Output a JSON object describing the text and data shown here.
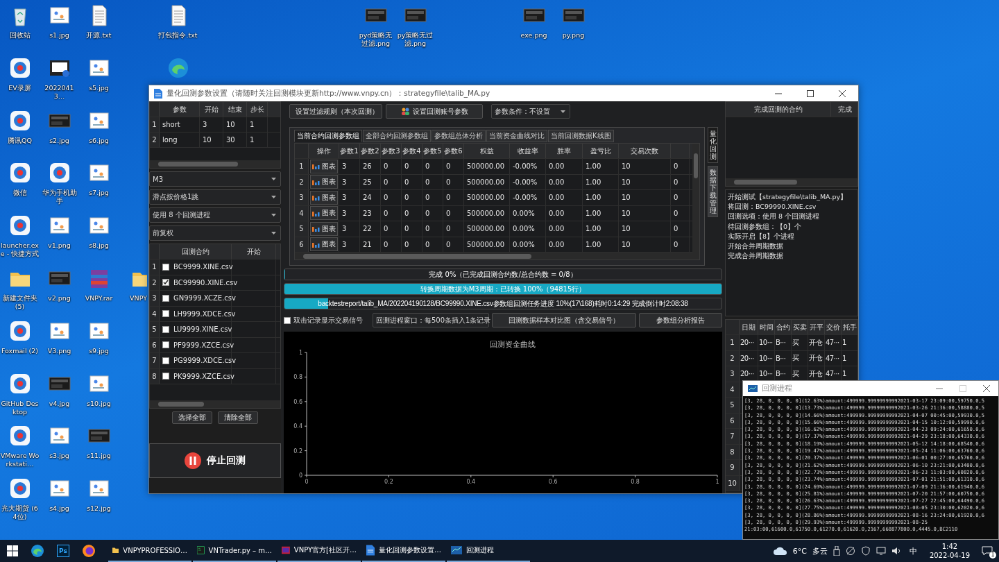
{
  "desktop": {
    "icons": [
      {
        "label": "回收站",
        "kind": "recycle"
      },
      {
        "label": "EV录屏",
        "kind": "app"
      },
      {
        "label": "腾讯QQ",
        "kind": "app"
      },
      {
        "label": "微信",
        "kind": "app"
      },
      {
        "label": "launcher.exe - 快捷方式",
        "kind": "app"
      },
      {
        "label": "新建文件夹 (5)",
        "kind": "folder"
      },
      {
        "label": "Foxmail (2)",
        "kind": "app"
      },
      {
        "label": "GitHub Desktop",
        "kind": "app"
      },
      {
        "label": "VMware Workstati…",
        "kind": "app"
      },
      {
        "label": "光大期货 (64位)",
        "kind": "app"
      },
      {
        "label": "s1.jpg",
        "kind": "image"
      },
      {
        "label": "20220413…",
        "kind": "video"
      },
      {
        "label": "s2.jpg",
        "kind": "dark"
      },
      {
        "label": "华为手机助手",
        "kind": "app"
      },
      {
        "label": "v1.png",
        "kind": "image"
      },
      {
        "label": "v2.png",
        "kind": "dark"
      },
      {
        "label": "V3.png",
        "kind": "image"
      },
      {
        "label": "v4.jpg",
        "kind": "dark"
      },
      {
        "label": "s3.jpg",
        "kind": "image"
      },
      {
        "label": "s4.jpg",
        "kind": "image"
      },
      {
        "label": "开源.txt",
        "kind": "text"
      },
      {
        "label": "s5.jpg",
        "kind": "image"
      },
      {
        "label": "s6.jpg",
        "kind": "image"
      },
      {
        "label": "s7.jpg",
        "kind": "image"
      },
      {
        "label": "s8.jpg",
        "kind": "image"
      },
      {
        "label": "VNPY.rar",
        "kind": "archive"
      },
      {
        "label": "s9.jpg",
        "kind": "image"
      },
      {
        "label": "s10.jpg",
        "kind": "image"
      },
      {
        "label": "s11.jpg",
        "kind": "dark"
      },
      {
        "label": "s12.jpg",
        "kind": "image"
      },
      {
        "label": "VNPY",
        "kind": "folder"
      },
      {
        "label": "打包指令.txt",
        "kind": "text"
      },
      {
        "kind": "edge"
      },
      {
        "label": "pyd策略无过滤.png",
        "kind": "dark"
      },
      {
        "label": "py策略无过滤.png",
        "kind": "dark"
      },
      {
        "label": "exe.png",
        "kind": "dark"
      },
      {
        "label": "py.png",
        "kind": "dark"
      }
    ]
  },
  "main_window": {
    "title": "量化回测参数设置（请随时关注回测模块更新http://www.vnpy.cn）：strategyfile\\talib_MA.py",
    "param_table": {
      "columns": [
        "参数",
        "开始",
        "结束",
        "步长"
      ],
      "rows": [
        {
          "no": "1",
          "cells": [
            "short",
            "3",
            "10",
            "1"
          ]
        },
        {
          "no": "2",
          "cells": [
            "long",
            "10",
            "30",
            "1"
          ]
        }
      ]
    },
    "dropdowns": [
      "M3",
      "滑点按价格1跳",
      "使用 8 个回测进程",
      "前复权"
    ],
    "contract_table": {
      "columns": [
        "回测合约",
        "开始"
      ],
      "rows": [
        {
          "no": "1",
          "name": "BC9999.XINE.csv",
          "checked": false
        },
        {
          "no": "2",
          "name": "BC99990.XINE.csv",
          "checked": true
        },
        {
          "no": "3",
          "name": "GN9999.XCZE.csv",
          "checked": false
        },
        {
          "no": "4",
          "name": "LH9999.XDCE.csv",
          "checked": false
        },
        {
          "no": "5",
          "name": "LU9999.XINE.csv",
          "checked": false
        },
        {
          "no": "6",
          "name": "PF9999.XZCE.csv",
          "checked": false
        },
        {
          "no": "7",
          "name": "PG9999.XDCE.csv",
          "checked": false
        },
        {
          "no": "8",
          "name": "PK9999.XZCE.csv",
          "checked": false
        }
      ]
    },
    "select_all_button": "选择全部",
    "clear_all_button": "清除全部",
    "stop_button": "停止回测",
    "filter_button": "设置过滤规则（本次回测）",
    "account_button": "设置回测账号参数",
    "condition_dropdown": "参数条件：不设置",
    "tabs": [
      {
        "label": "当前合约回测参数组",
        "selected": true
      },
      {
        "label": "全部合约回测参数组",
        "selected": false
      },
      {
        "label": "参数组总体分析",
        "selected": false
      },
      {
        "label": "当前资金曲线对比",
        "selected": false
      },
      {
        "label": "当前回测数据K线图",
        "selected": false
      }
    ],
    "result_table": {
      "columns": [
        "操作",
        "参数1",
        "参数2",
        "参数3",
        "参数4",
        "参数5",
        "参数6",
        "权益",
        "收益率",
        "胜率",
        "盈亏比",
        "交易次数"
      ],
      "rows": [
        {
          "no": "1",
          "cells": [
            "图表",
            "3",
            "26",
            "0",
            "0",
            "0",
            "0",
            "500000.00",
            "-0.00%",
            "0.00",
            "1.00",
            "10",
            "0"
          ]
        },
        {
          "no": "2",
          "cells": [
            "图表",
            "3",
            "25",
            "0",
            "0",
            "0",
            "0",
            "500000.00",
            "-0.00%",
            "0.00",
            "1.00",
            "10",
            "0"
          ]
        },
        {
          "no": "3",
          "cells": [
            "图表",
            "3",
            "24",
            "0",
            "0",
            "0",
            "0",
            "500000.00",
            "-0.00%",
            "0.00",
            "1.00",
            "10",
            "0"
          ]
        },
        {
          "no": "4",
          "cells": [
            "图表",
            "3",
            "23",
            "0",
            "0",
            "0",
            "0",
            "500000.00",
            "0.00%",
            "0.00",
            "1.00",
            "10",
            "0"
          ]
        },
        {
          "no": "5",
          "cells": [
            "图表",
            "3",
            "22",
            "0",
            "0",
            "0",
            "0",
            "500000.00",
            "0.00%",
            "0.00",
            "1.00",
            "10",
            "0"
          ]
        },
        {
          "no": "6",
          "cells": [
            "图表",
            "3",
            "21",
            "0",
            "0",
            "0",
            "0",
            "500000.00",
            "0.00%",
            "0.00",
            "1.00",
            "10",
            "0"
          ]
        }
      ]
    },
    "side_tabs": [
      {
        "label": "量化回测",
        "selected": true
      },
      {
        "label": "数据下载管理",
        "selected": false
      }
    ],
    "progress": [
      {
        "text": "完成 0%（已完成回测合约数/总合约数 = 0/8）",
        "level": 0
      },
      {
        "text": "转换周期数据为M3周期：已转换 100%（94815行）",
        "level": 1
      },
      {
        "text": "backtestreport/talib_MA/202204190128/BC99990.XINE.csv参数组回测任务进度 10%(17\\168)耗时0:14:29 完成倒计时2:08:38",
        "level": 0.1
      }
    ],
    "signal_checkbox": {
      "label": "双击记录显示交易信号",
      "checked": false
    },
    "log_dropdown": "回测进程窗口：每500条插入1条记录",
    "compare_button": "回测数据样本对比图（含交易信号）",
    "report_button": "参数组分析报告",
    "chart_data": {
      "type": "line",
      "title": "回测资金曲线",
      "xlim": [
        0,
        1
      ],
      "ylim": [
        0,
        1
      ],
      "xticks": [
        0,
        0.2,
        0.4,
        0.6,
        0.8,
        1
      ],
      "yticks": [
        0,
        0.2,
        0.4,
        0.6,
        0.8,
        1
      ]
    },
    "done_table": {
      "columns": [
        "完成回测的合约",
        "完成"
      ]
    },
    "log": [
      "开始测试【strategyfile\\talib_MA.py】",
      "将回测：BC99990.XINE.csv",
      "回测选项：使用 8 个回测进程",
      "待回测参数组：【0】个",
      "实际开启【8】个进程",
      "开始合并周期数据",
      "完成合并周期数据"
    ],
    "trade_table": {
      "columns": [
        "日期",
        "时间",
        "合约",
        "买卖",
        "开平",
        "交价",
        "托手"
      ],
      "rows": [
        {
          "no": "1",
          "cells": [
            "20···",
            "10···",
            "B···",
            "买",
            "开仓",
            "47···",
            "1"
          ]
        },
        {
          "no": "2",
          "cells": [
            "20···",
            "10···",
            "B···",
            "买",
            "开仓",
            "47···",
            "1"
          ]
        },
        {
          "no": "3",
          "cells": [
            "20···",
            "10···",
            "B···",
            "买",
            "开仓",
            "47···",
            "1"
          ]
        },
        {
          "no": "4"
        },
        {
          "no": "5"
        },
        {
          "no": "6"
        },
        {
          "no": "7"
        },
        {
          "no": "8"
        },
        {
          "no": "9"
        },
        {
          "no": "10"
        }
      ]
    }
  },
  "progress_window": {
    "title": "回测进程",
    "lines": [
      "[3, 28, 0, 0, 0, 0](12.63%)amount:499999.99999999992021-03-17 23:09:00,59750.0,5",
      "[3, 28, 0, 0, 0, 0](13.73%)amount:499999.99999999992021-03-26 21:36:00,58880.0,5",
      "[3, 28, 0, 0, 0, 0](14.66%)amount:499999.99999999992021-04-07 00:45:00,59930.0,5",
      "[3, 28, 0, 0, 0, 0](15.66%)amount:499999.99999999992021-04-15 10:12:00,59990.0,6",
      "[3, 28, 0, 0, 0, 0](16.62%)amount:499999.99999999992021-04-23 09:24:00,61650.0,6",
      "[3, 28, 0, 0, 0, 0](17.37%)amount:499999.99999999992021-04-29 23:18:00,64330.0,6",
      "[3, 28, 0, 0, 0, 0](18.19%)amount:499999.99999999992021-05-12 14:18:00,68540.0,6",
      "[3, 28, 0, 0, 0, 0](19.47%)amount:499999.99999999992021-05-24 11:06:00,63760.0,6",
      "[3, 28, 0, 0, 0, 0](20.37%)amount:499999.99999999992021-06-01 00:27:00,65760.0,6",
      "[3, 28, 0, 0, 0, 0](21.62%)amount:499999.99999999992021-06-10 23:21:00,63400.0,6",
      "[3, 28, 0, 0, 0, 0](22.73%)amount:499999.99999999992021-06-23 11:03:00,60820.0,6",
      "[3, 28, 0, 0, 0, 0](23.74%)amount:499999.99999999992021-07-01 21:51:00,61310.0,6",
      "[3, 28, 0, 0, 0, 0](24.69%)amount:499999.99999999992021-07-09 21:36:00,61940.0,6",
      "[3, 28, 0, 0, 0, 0](25.81%)amount:499999.99999999992021-07-20 21:57:00,60750.0,6",
      "[3, 28, 0, 0, 0, 0](26.63%)amount:499999.99999999992021-07-27 22:45:00,64490.0,6",
      "[3, 28, 0, 0, 0, 0](27.75%)amount:499999.99999999992021-08-05 23:30:00,62020.0,6",
      "[3, 28, 0, 0, 0, 0](28.86%)amount:499999.99999999992021-08-16 23:24:00,61920.0,6",
      "[3, 28, 0, 0, 0, 0](29.93%)amount:499999.99999999992021-08-25",
      "21:03:00,61600.0,61750.0,61270.0,61620.0,2167,668877800.0,4445.0,BC2110"
    ]
  },
  "taskbar": {
    "pinned": [
      {
        "kind": "edge"
      },
      {
        "kind": "ps",
        "label": "Ps"
      },
      {
        "kind": "firefox"
      }
    ],
    "apps": [
      {
        "label": "VNPYPROFESSIO…",
        "kind": "folder"
      },
      {
        "label": "VNTrader.py – m…",
        "kind": "pc"
      },
      {
        "label": "VNPY官方[社区开…",
        "kind": "vnpy"
      },
      {
        "label": "量化回测参数设置…",
        "kind": "doc"
      },
      {
        "label": "回测进程",
        "kind": "monitor"
      }
    ],
    "temperature": "6°C",
    "weather": "多云",
    "ime": "中",
    "time": "1:42",
    "date": "2022-04-19",
    "notifications": "1"
  }
}
